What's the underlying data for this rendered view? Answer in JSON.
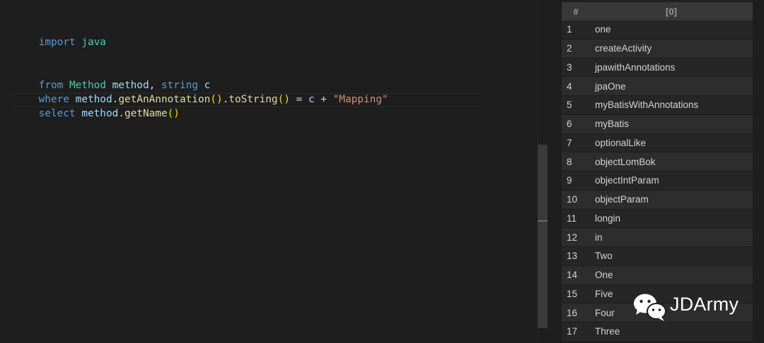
{
  "code": {
    "line1": {
      "k": "import",
      "v": "java"
    },
    "line4": {
      "k": "from",
      "t": "Method",
      "v1": "method",
      "comma": ",",
      "k2": "string",
      "v2": "c"
    },
    "line5": {
      "k": "where",
      "v1": "method",
      "dot1": ".",
      "f1": "getAnAnnotation",
      "p1": "()",
      "dot2": ".",
      "f2": "toString",
      "p2": "()",
      "eq": "=",
      "v2": "c",
      "plus": "+",
      "s": "\"Mapping\""
    },
    "line6": {
      "k": "select",
      "v": "method",
      "dot": ".",
      "f": "getName",
      "p": "()"
    }
  },
  "results": {
    "header_index": "#",
    "header_col": "[0]",
    "rows": [
      {
        "i": "1",
        "v": "one"
      },
      {
        "i": "2",
        "v": "createActivity"
      },
      {
        "i": "3",
        "v": "jpawithAnnotations"
      },
      {
        "i": "4",
        "v": "jpaOne"
      },
      {
        "i": "5",
        "v": "myBatisWithAnnotations"
      },
      {
        "i": "6",
        "v": "myBatis"
      },
      {
        "i": "7",
        "v": "optionalLike"
      },
      {
        "i": "8",
        "v": "objectLomBok"
      },
      {
        "i": "9",
        "v": "objectIntParam"
      },
      {
        "i": "10",
        "v": "objectParam"
      },
      {
        "i": "11",
        "v": "longin"
      },
      {
        "i": "12",
        "v": "in"
      },
      {
        "i": "13",
        "v": "Two"
      },
      {
        "i": "14",
        "v": "One"
      },
      {
        "i": "15",
        "v": "Five"
      },
      {
        "i": "16",
        "v": "Four"
      },
      {
        "i": "17",
        "v": "Three"
      }
    ]
  },
  "watermark": {
    "text": "JDArmy",
    "icon": "wechat-icon"
  }
}
